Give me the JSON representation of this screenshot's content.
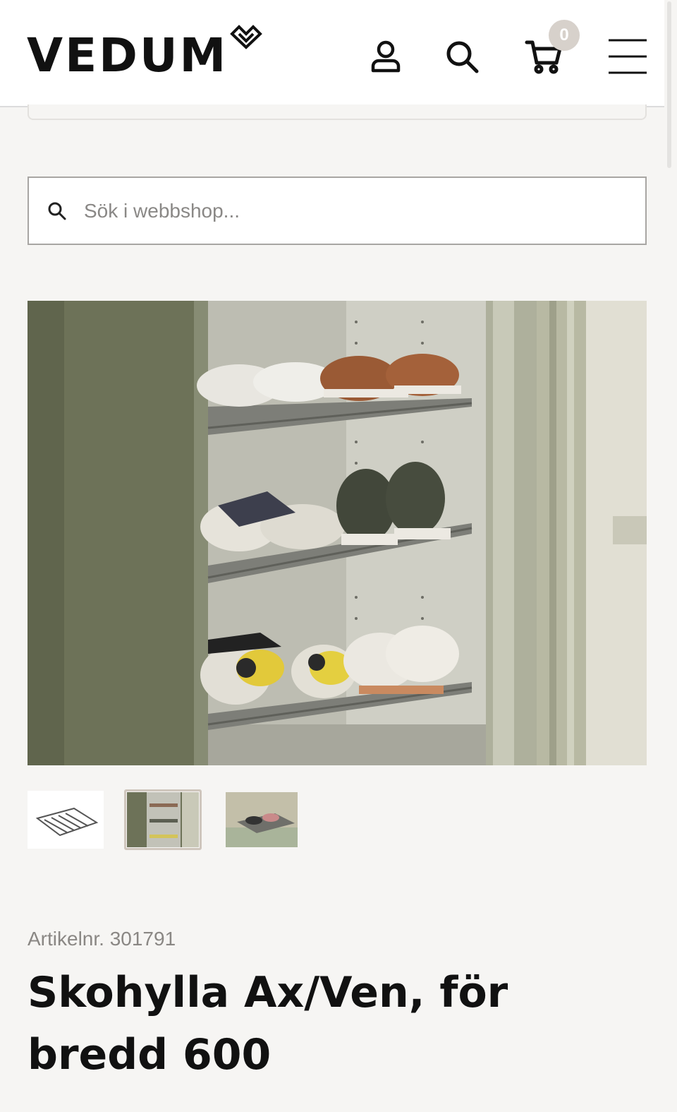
{
  "header": {
    "logo_text": "VEDUM",
    "cart_count": "0",
    "icons": [
      "account-icon",
      "search-icon",
      "cart-icon",
      "menu-icon"
    ]
  },
  "search": {
    "placeholder": "Sök i webbshop..."
  },
  "gallery": {
    "thumbnails": [
      "shelf-product-thumbnail",
      "closet-shoes-thumbnail",
      "shelf-in-drawer-thumbnail"
    ],
    "active_index": 1
  },
  "product": {
    "article_label": "Artikelnr. 301791",
    "title": "Skohylla Ax/Ven, för bredd 600"
  },
  "colors": {
    "background": "#f6f5f3",
    "accent_badge": "#d7d1cb",
    "text": "#111111",
    "muted_text": "#8a8784"
  }
}
